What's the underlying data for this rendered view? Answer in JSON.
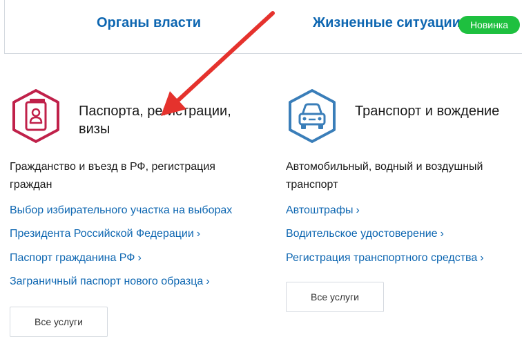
{
  "topbar": {
    "authorities_label": "Органы власти",
    "situations_label": "Жизненные ситуации",
    "new_badge": "Новинка"
  },
  "categories": [
    {
      "title": "Паспорта, регистрации, визы",
      "icon": "passport-icon",
      "icon_color": "#c0214a",
      "description": "Гражданство и въезд в РФ, регистрация граждан",
      "links": [
        "Выбор избирательного участка на выборах",
        "Президента Российской Федерации",
        "Паспорт гражданина РФ",
        "Заграничный паспорт нового образца"
      ],
      "all_services": "Все услуги"
    },
    {
      "title": "Транспорт и вождение",
      "icon": "car-icon",
      "icon_color": "#3a7eb9",
      "description": "Автомобильный, водный и воздушный транспорт",
      "links": [
        "Автоштрафы",
        "Водительское удостоверение",
        "Регистрация транспортного средства"
      ],
      "all_services": "Все услуги"
    }
  ],
  "colors": {
    "link": "#0d66b1",
    "badge": "#1ec03f",
    "arrow": "#e5322d"
  }
}
